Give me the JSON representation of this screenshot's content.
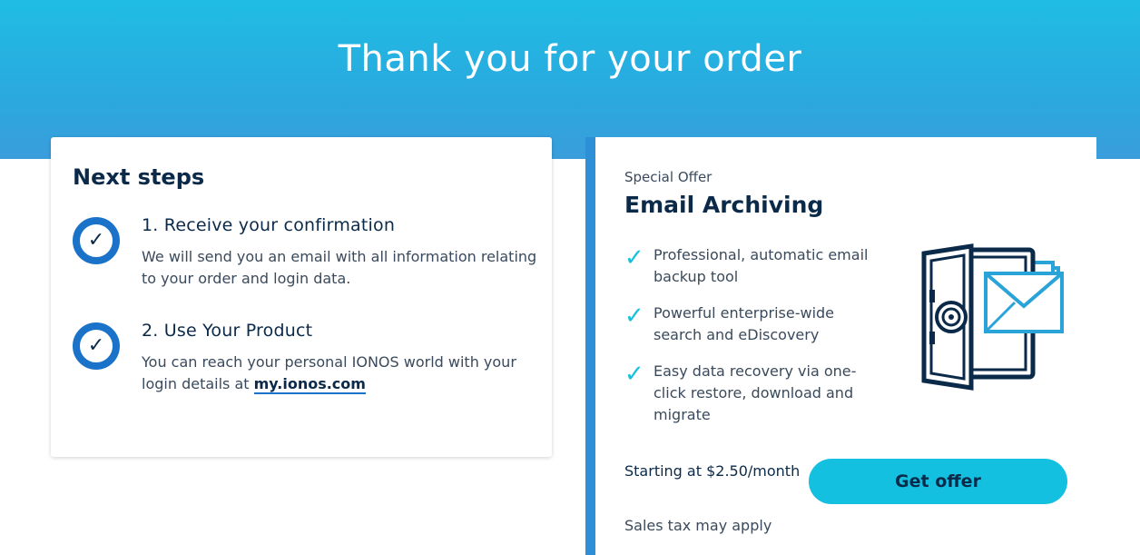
{
  "header": {
    "title": "Thank you for your order"
  },
  "next_steps": {
    "heading": "Next steps",
    "steps": [
      {
        "title": "1. Receive your confirmation",
        "text": "We will send you an email with all information relating to your order and login data."
      },
      {
        "title": "2. Use Your Product",
        "text_before_link": "You can reach your personal IONOS world with your login details at ",
        "link": "my.ionos.com"
      }
    ],
    "check_glyph": "✓"
  },
  "offer": {
    "label": "Special Offer",
    "title": "Email Archiving",
    "tick_glyph": "✓",
    "features": [
      "Professional, automatic email backup tool",
      "Powerful enterprise-wide search and eDiscovery",
      "Easy data recovery via one-click restore, download and migrate"
    ],
    "illustration_icon": "safe-with-envelopes-icon",
    "price": "Starting at $2.50/month",
    "cta_label": "Get offer",
    "tax_note": "Sales tax may apply"
  },
  "colors": {
    "hero_top": "#1fbde4",
    "hero_bottom": "#3a9ddb",
    "navy": "#0b2a4a",
    "accent_blue": "#1a73c9",
    "cta": "#14c0e0"
  }
}
